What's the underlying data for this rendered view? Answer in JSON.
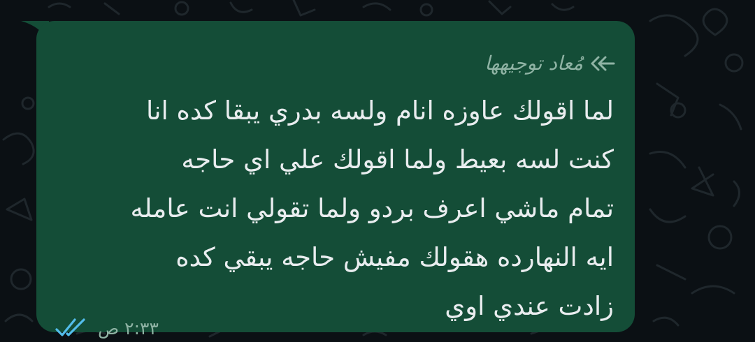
{
  "colors": {
    "background": "#0b1014",
    "bubble": "#144d37",
    "text": "#e9edef",
    "meta": "#8fb3a4",
    "read_ticks": "#53bdeb",
    "doodle": "#1f272c"
  },
  "message": {
    "forwarded_label": "مُعاد توجيهها",
    "forward_icon": "double-forward-arrow-icon",
    "lines": [
      "لما اقولك عاوزه انام ولسه بدري يبقا كده انا",
      "كنت لسه بعيط ولما اقولك علي اي حاجه",
      "تمام ماشي اعرف بردو ولما تقولي انت عامله",
      "ايه النهارده هقولك مفيش حاجه يبقي كده",
      "زادت عندي اوي"
    ],
    "time": "٢:٣٣ ص",
    "status_icon": "double-check-read-icon"
  }
}
